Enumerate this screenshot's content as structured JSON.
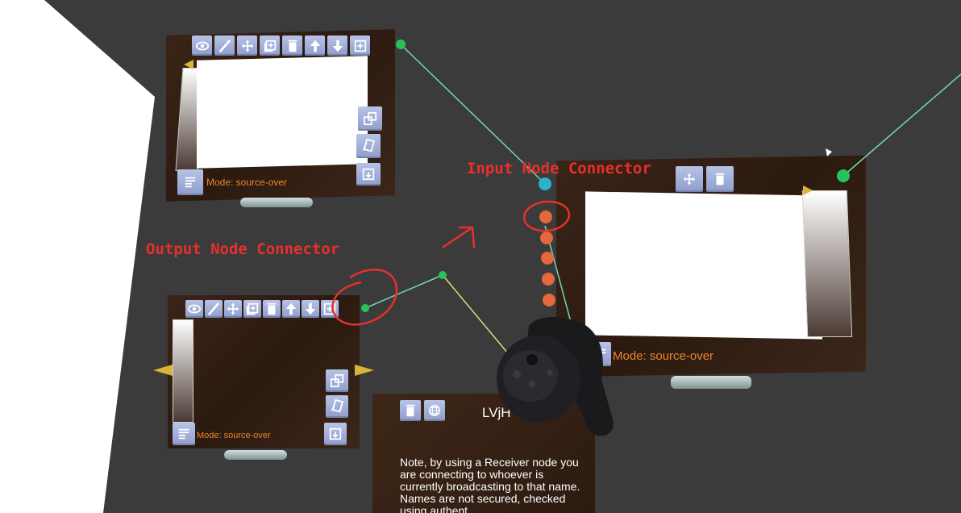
{
  "labels": {
    "input_connector": "Input Node Connector",
    "output_connector": "Output Node Connector"
  },
  "layer_panels": {
    "top_left": {
      "mode": "Mode: source-over"
    },
    "bottom_left": {
      "mode": "Mode: source-over"
    },
    "right": {
      "mode": "Mode: source-over"
    }
  },
  "receiver_panel": {
    "name": "LVjH",
    "note": "Note, by using a Receiver node you are connecting to whoever is currently broadcasting to that name. Names are not secured, checked using authent..."
  },
  "icons": {
    "toolbar": [
      "eye-icon",
      "brush-icon",
      "move-icon",
      "add-layer-icon",
      "trash-icon",
      "arrow-up-icon",
      "arrow-down-icon",
      "add-output-icon"
    ],
    "side": [
      "resize-icon",
      "layers-icon",
      "merge-down-icon",
      "menu-grid-icon"
    ],
    "receiver": [
      "trash-icon",
      "globe-icon"
    ],
    "controller": "vr-controller-icon"
  },
  "colors": {
    "background": "#3b3b3b",
    "annotation": "#e8302b",
    "mode_text": "#e8862a",
    "button": "#9eabd8",
    "connector_green": "#27c25a",
    "connector_input": "#2db3c9",
    "connector_orange": "#e5673c",
    "wire_cyan": "#6fd9b2",
    "wire_yellow": "#d6e07a"
  }
}
